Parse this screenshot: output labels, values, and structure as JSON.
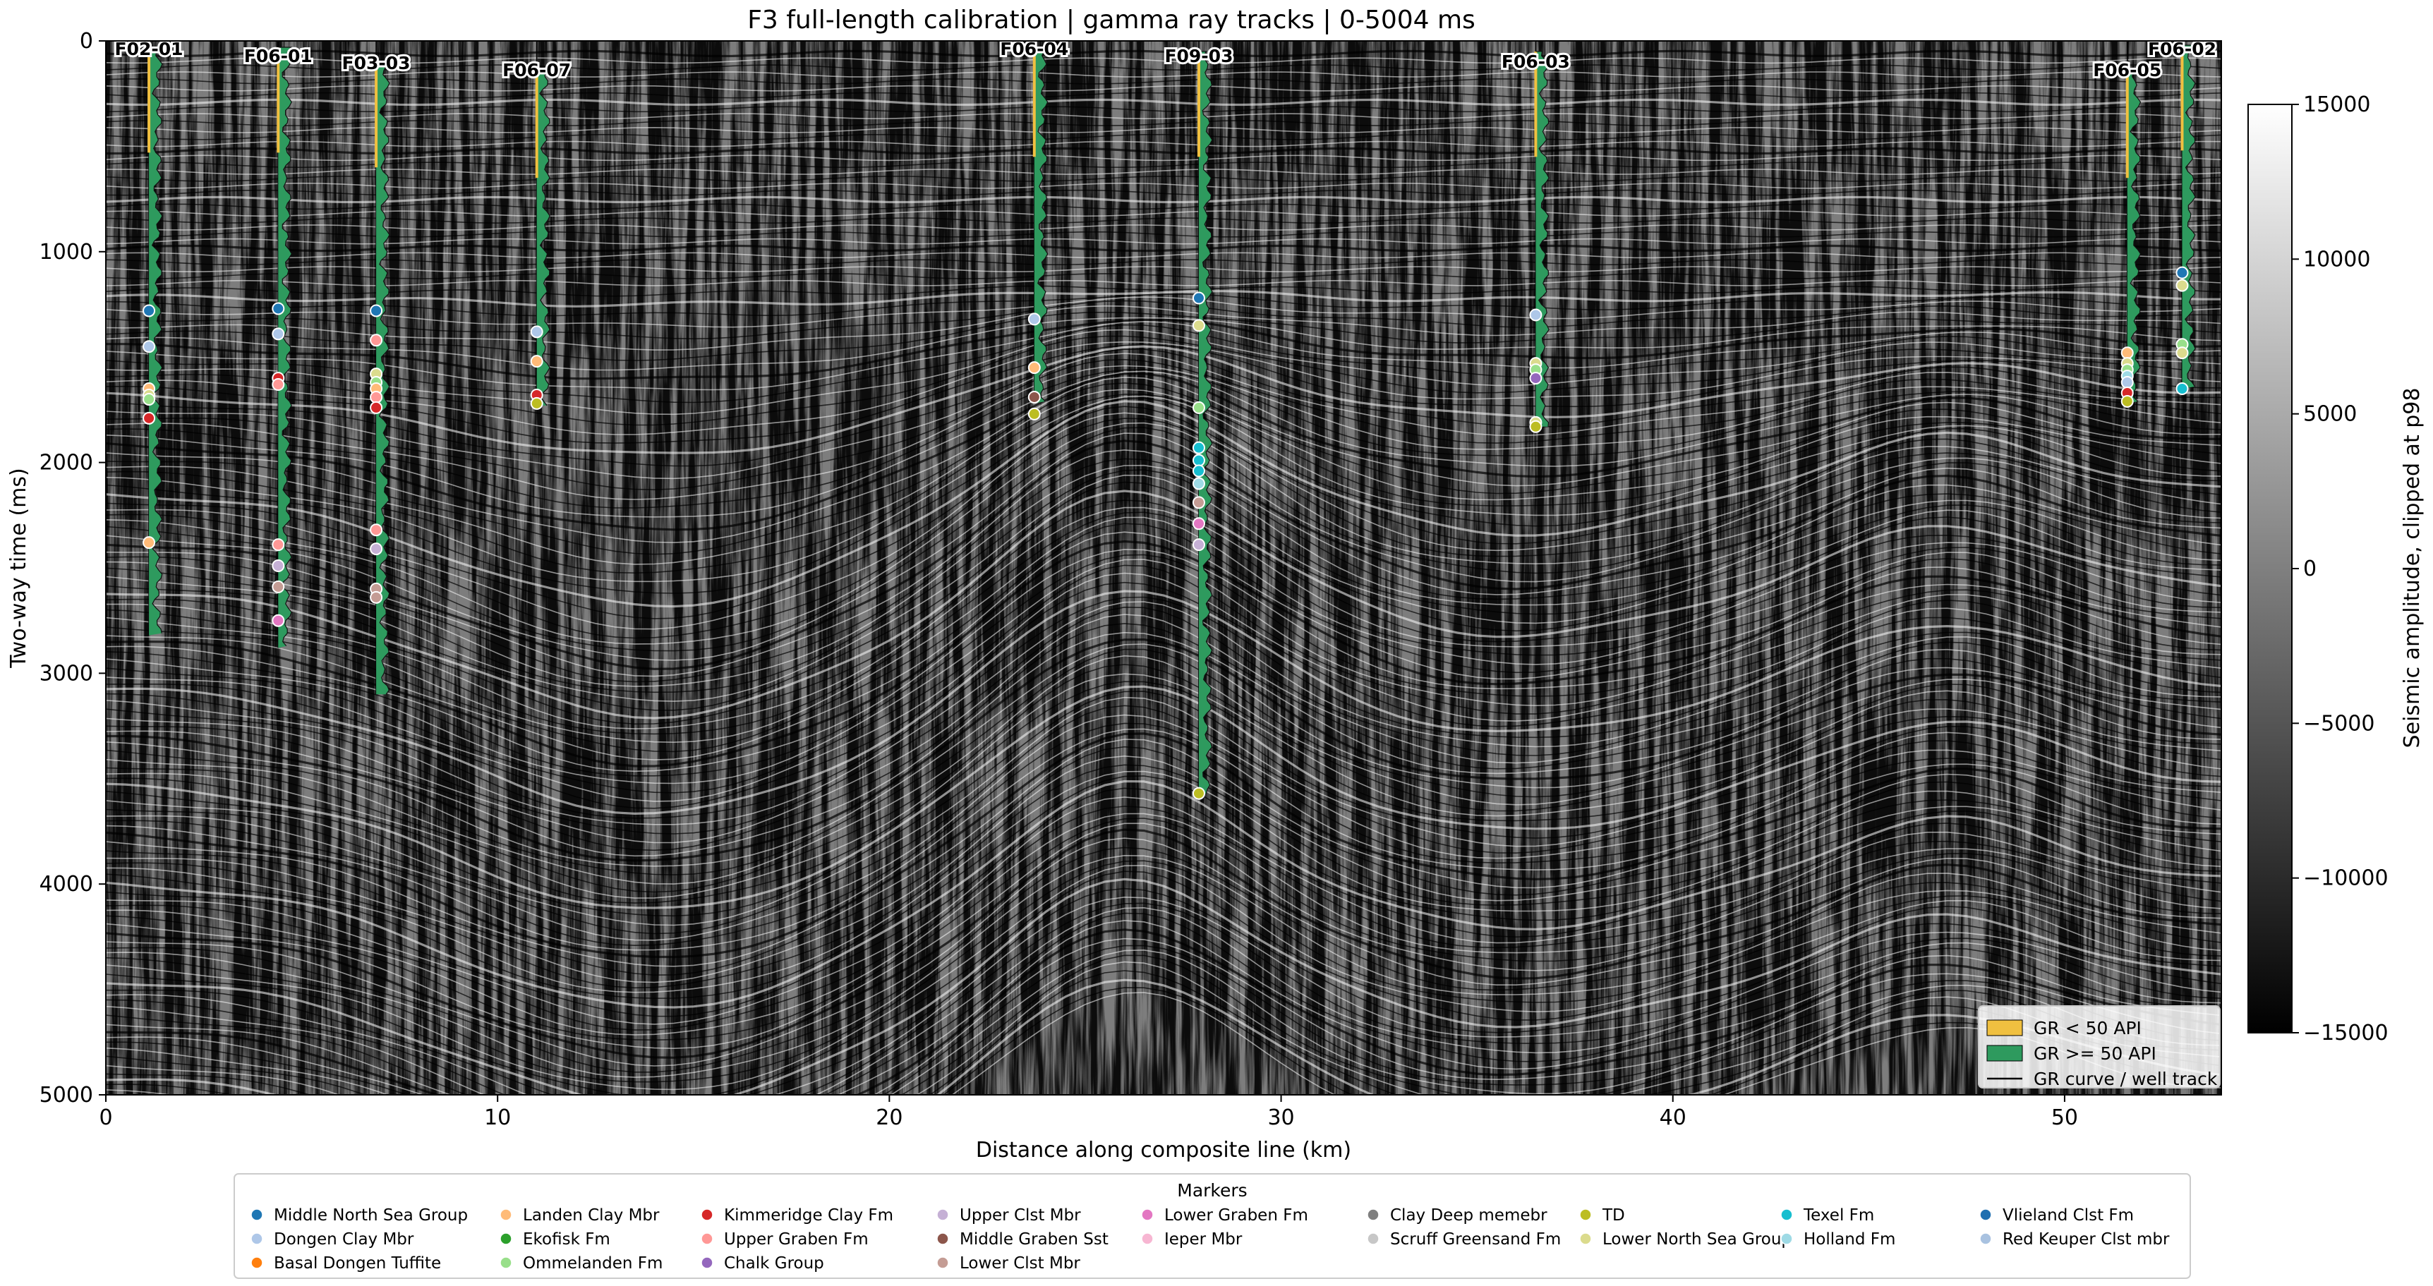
{
  "chart_data": {
    "type": "seismic-section",
    "title": "F3 full-length calibration | gamma ray tracks | 0-5004 ms",
    "xlabel": "Distance along composite line (km)",
    "ylabel": "Two-way time (ms)",
    "xlim": [
      0,
      54
    ],
    "ylim": [
      5000,
      0
    ],
    "xticks": [
      0,
      10,
      20,
      30,
      40,
      50
    ],
    "yticks": [
      0,
      1000,
      2000,
      3000,
      4000,
      5000
    ],
    "image_colormap": "greys",
    "colorbar": {
      "label": "Seismic amplitude, clipped at p98",
      "range": [
        -15000,
        15000
      ],
      "ticks": [
        15000,
        10000,
        5000,
        0,
        -5000,
        -10000,
        -15000
      ],
      "tick_labels": [
        "15000",
        "10000",
        "5000",
        "0",
        "−10000",
        "−10000",
        "−15000"
      ]
    },
    "legend_gr": {
      "placement": "lower-right",
      "entries": [
        {
          "label": "GR < 50 API",
          "color": "#f0c040",
          "kind": "patch"
        },
        {
          "label": "GR >= 50 API",
          "color": "#2e9a5e",
          "kind": "patch"
        },
        {
          "label": "GR curve / well track",
          "color": "#000000",
          "kind": "line"
        }
      ]
    },
    "wells": [
      {
        "name": "F02-01",
        "x": 1.1,
        "top": 30,
        "bottom": 2820
      },
      {
        "name": "F06-01",
        "x": 4.4,
        "top": 30,
        "bottom": 2880
      },
      {
        "name": "F03-03",
        "x": 6.9,
        "top": 100,
        "bottom": 3100
      },
      {
        "name": "F06-07",
        "x": 11.0,
        "top": 150,
        "bottom": 1730
      },
      {
        "name": "F06-04",
        "x": 23.7,
        "top": 50,
        "bottom": 1720
      },
      {
        "name": "F09-03",
        "x": 27.9,
        "top": 50,
        "bottom": 3580
      },
      {
        "name": "F06-03",
        "x": 36.5,
        "top": 50,
        "bottom": 1830
      },
      {
        "name": "F06-05",
        "x": 51.6,
        "top": 150,
        "bottom": 1720
      },
      {
        "name": "F06-02",
        "x": 53.0,
        "top": 20,
        "bottom": 1650
      }
    ],
    "markers": [
      {
        "well": "F02-01",
        "marker": "Middle North Sea Group",
        "t": 1280
      },
      {
        "well": "F02-01",
        "marker": "Dongen Clay Mbr",
        "t": 1450
      },
      {
        "well": "F02-01",
        "marker": "Landen Clay Mbr",
        "t": 1650
      },
      {
        "well": "F02-01",
        "marker": "Lower North Sea Group",
        "t": 1680
      },
      {
        "well": "F02-01",
        "marker": "Ommelanden Fm",
        "t": 1700
      },
      {
        "well": "F02-01",
        "marker": "Kimmeridge Clay Fm",
        "t": 1790
      },
      {
        "well": "F02-01",
        "marker": "Landen Clay Mbr",
        "t": 2380
      },
      {
        "well": "F06-01",
        "marker": "Middle North Sea Group",
        "t": 1270
      },
      {
        "well": "F06-01",
        "marker": "Dongen Clay Mbr",
        "t": 1390
      },
      {
        "well": "F06-01",
        "marker": "Kimmeridge Clay Fm",
        "t": 1600
      },
      {
        "well": "F06-01",
        "marker": "Upper Graben Fm",
        "t": 1630
      },
      {
        "well": "F06-01",
        "marker": "Upper Graben Fm",
        "t": 2390
      },
      {
        "well": "F06-01",
        "marker": "Upper Clst Mbr",
        "t": 2490
      },
      {
        "well": "F06-01",
        "marker": "Lower Clst Mbr",
        "t": 2590
      },
      {
        "well": "F06-01",
        "marker": "Lower Graben Fm",
        "t": 2750
      },
      {
        "well": "F03-03",
        "marker": "Middle North Sea Group",
        "t": 1280
      },
      {
        "well": "F03-03",
        "marker": "Upper Graben Fm",
        "t": 1420
      },
      {
        "well": "F03-03",
        "marker": "Lower North Sea Group",
        "t": 1580
      },
      {
        "well": "F03-03",
        "marker": "Ommelanden Fm",
        "t": 1620
      },
      {
        "well": "F03-03",
        "marker": "Landen Clay Mbr",
        "t": 1650
      },
      {
        "well": "F03-03",
        "marker": "Upper Graben Fm",
        "t": 1690
      },
      {
        "well": "F03-03",
        "marker": "Kimmeridge Clay Fm",
        "t": 1740
      },
      {
        "well": "F03-03",
        "marker": "Upper Graben Fm",
        "t": 2320
      },
      {
        "well": "F03-03",
        "marker": "Upper Clst Mbr",
        "t": 2410
      },
      {
        "well": "F03-03",
        "marker": "Lower Clst Mbr",
        "t": 2600
      },
      {
        "well": "F03-03",
        "marker": "Lower Clst Mbr",
        "t": 2640
      },
      {
        "well": "F06-07",
        "marker": "Dongen Clay Mbr",
        "t": 1380
      },
      {
        "well": "F06-07",
        "marker": "Landen Clay Mbr",
        "t": 1520
      },
      {
        "well": "F06-07",
        "marker": "Kimmeridge Clay Fm",
        "t": 1680
      },
      {
        "well": "F06-07",
        "marker": "TD",
        "t": 1720
      },
      {
        "well": "F06-04",
        "marker": "Dongen Clay Mbr",
        "t": 1320
      },
      {
        "well": "F06-04",
        "marker": "Landen Clay Mbr",
        "t": 1550
      },
      {
        "well": "F06-04",
        "marker": "Middle Graben Sst",
        "t": 1690
      },
      {
        "well": "F06-04",
        "marker": "TD",
        "t": 1770
      },
      {
        "well": "F09-03",
        "marker": "Middle North Sea Group",
        "t": 1220
      },
      {
        "well": "F09-03",
        "marker": "Lower North Sea Group",
        "t": 1350
      },
      {
        "well": "F09-03",
        "marker": "Ommelanden Fm",
        "t": 1740
      },
      {
        "well": "F09-03",
        "marker": "Texel Fm",
        "t": 1930
      },
      {
        "well": "F09-03",
        "marker": "Texel Fm",
        "t": 1990
      },
      {
        "well": "F09-03",
        "marker": "Texel Fm",
        "t": 2040
      },
      {
        "well": "F09-03",
        "marker": "Holland Fm",
        "t": 2100
      },
      {
        "well": "F09-03",
        "marker": "Lower Clst Mbr",
        "t": 2190
      },
      {
        "well": "F09-03",
        "marker": "Lower Graben Fm",
        "t": 2290
      },
      {
        "well": "F09-03",
        "marker": "Upper Clst Mbr",
        "t": 2390
      },
      {
        "well": "F09-03",
        "marker": "TD",
        "t": 3570
      },
      {
        "well": "F06-03",
        "marker": "Dongen Clay Mbr",
        "t": 1300
      },
      {
        "well": "F06-03",
        "marker": "Lower North Sea Group",
        "t": 1530
      },
      {
        "well": "F06-03",
        "marker": "Ommelanden Fm",
        "t": 1560
      },
      {
        "well": "F06-03",
        "marker": "Chalk Group",
        "t": 1600
      },
      {
        "well": "F06-03",
        "marker": "Lower North Sea Group",
        "t": 1810
      },
      {
        "well": "F06-03",
        "marker": "TD",
        "t": 1830
      },
      {
        "well": "F06-05",
        "marker": "Landen Clay Mbr",
        "t": 1480
      },
      {
        "well": "F06-05",
        "marker": "Lower North Sea Group",
        "t": 1530
      },
      {
        "well": "F06-05",
        "marker": "Ommelanden Fm",
        "t": 1560
      },
      {
        "well": "F06-05",
        "marker": "Holland Fm",
        "t": 1590
      },
      {
        "well": "F06-05",
        "marker": "Dongen Clay Mbr",
        "t": 1620
      },
      {
        "well": "F06-05",
        "marker": "Kimmeridge Clay Fm",
        "t": 1670
      },
      {
        "well": "F06-05",
        "marker": "TD",
        "t": 1710
      },
      {
        "well": "F06-02",
        "marker": "Middle North Sea Group",
        "t": 1100
      },
      {
        "well": "F06-02",
        "marker": "Lower North Sea Group",
        "t": 1160
      },
      {
        "well": "F06-02",
        "marker": "Ommelanden Fm",
        "t": 1440
      },
      {
        "well": "F06-02",
        "marker": "Lower North Sea Group",
        "t": 1480
      },
      {
        "well": "F06-02",
        "marker": "Texel Fm",
        "t": 1650
      }
    ],
    "legend_markers": {
      "title": "Markers",
      "placement": "bottom-center",
      "ncol": 9,
      "entries": [
        {
          "label": "Middle North Sea Group",
          "color": "#1f77b4"
        },
        {
          "label": "Dongen Clay Mbr",
          "color": "#aec7e8"
        },
        {
          "label": "Basal Dongen Tuffite",
          "color": "#ff7f0e"
        },
        {
          "label": "Landen Clay Mbr",
          "color": "#ffbb78"
        },
        {
          "label": "Ekofisk Fm",
          "color": "#2ca02c"
        },
        {
          "label": "Ommelanden Fm",
          "color": "#98df8a"
        },
        {
          "label": "Kimmeridge Clay Fm",
          "color": "#d62728"
        },
        {
          "label": "Upper Graben Fm",
          "color": "#ff9896"
        },
        {
          "label": "Chalk Group",
          "color": "#9467bd"
        },
        {
          "label": "Upper Clst Mbr",
          "color": "#c5b0d5"
        },
        {
          "label": "Middle Graben Sst",
          "color": "#8c564b"
        },
        {
          "label": "Lower Clst Mbr",
          "color": "#c49c94"
        },
        {
          "label": "Lower Graben Fm",
          "color": "#e377c2"
        },
        {
          "label": "Ieper Mbr",
          "color": "#f7b6d2"
        },
        {
          "label": "Clay Deep memebr",
          "color": "#7f7f7f"
        },
        {
          "label": "Scruff Greensand Fm",
          "color": "#c7c7c7"
        },
        {
          "label": "TD",
          "color": "#bcbd22"
        },
        {
          "label": "Lower North Sea Group",
          "color": "#dbdb8d"
        },
        {
          "label": "Texel Fm",
          "color": "#17becf"
        },
        {
          "label": "Holland Fm",
          "color": "#9edae5"
        },
        {
          "label": "Vlieland Clst Fm",
          "color": "#1f6fb0"
        },
        {
          "label": "Red Keuper Clst mbr",
          "color": "#a9c2e0"
        }
      ]
    }
  }
}
